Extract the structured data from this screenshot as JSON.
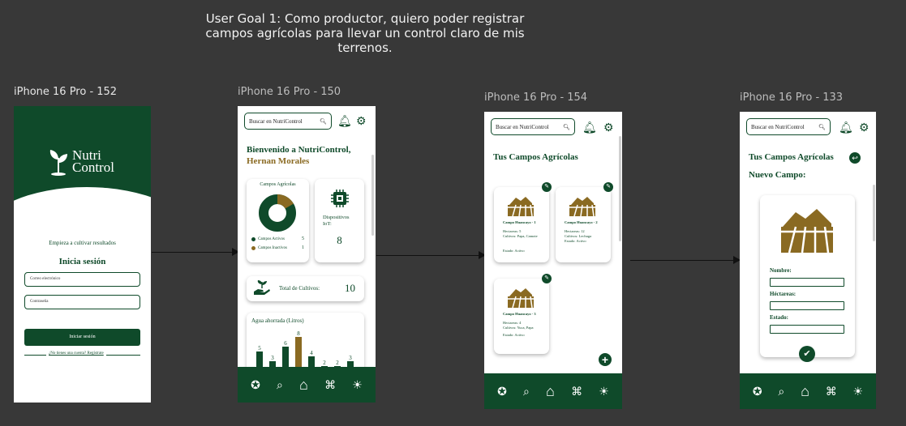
{
  "goal": {
    "line1": "User Goal 1: Como productor, quiero poder registrar",
    "line2": "campos agrícolas para llevar un control claro de mis",
    "line3": "terrenos."
  },
  "frames": [
    {
      "label": "iPhone 16 Pro - 152"
    },
    {
      "label": "iPhone 16 Pro - 150"
    },
    {
      "label": "iPhone 16 Pro - 154"
    },
    {
      "label": "iPhone 16 Pro - 133"
    }
  ],
  "login": {
    "logo_line1": "Nutri",
    "logo_line2": "Control",
    "tagline": "Empieza a cultivar resultados",
    "heading": "Inicia sesión",
    "email_placeholder": "Correo electrónico",
    "password_placeholder": "Contraseña",
    "submit": "Iniciar sesión",
    "register": "¿No tienes una cuenta? Regístrate"
  },
  "search_placeholder": "Buscar en NutriControl",
  "dashboard": {
    "welcome": "Bienvenido a NutriControl,",
    "user": "Hernan Morales",
    "fields_title": "Campos Agrícolas",
    "active_label": "Campos Activos",
    "active_count": "5",
    "inactive_label": "Campos Inactivos",
    "inactive_count": "1",
    "iot_label": "Dispositivos IoT:",
    "iot_count": "8",
    "crops_label": "Total de Cultivos:",
    "crops_count": "10",
    "water_title": "Agua ahorrada (Litros)"
  },
  "chart_data": {
    "type": "bar",
    "title": "Agua ahorrada (Litros)",
    "values": [
      5,
      3,
      6,
      8,
      4,
      2,
      2,
      3
    ],
    "highlight_index": 3,
    "colors": {
      "normal": "#0f4a2a",
      "highlight": "#8a6a22"
    }
  },
  "fields_list": {
    "title": "Tus Campos Agrícolas",
    "items": [
      {
        "name": "Campo Huancayo - 1",
        "hectares": "Hectareas: 5",
        "crops": "Cultivos: Papa, Camote",
        "status": "Estado: Activo"
      },
      {
        "name": "Campo Huancayo - 2",
        "hectares": "Hectareas: 12",
        "crops": "Cultivos: Lechuga",
        "status": "Estado: Activo"
      },
      {
        "name": "Campo Huancayo - 3",
        "hectares": "Hectareas: 4",
        "crops": "Cultivos: Yuca, Papa",
        "status": "Estado: Activo"
      }
    ]
  },
  "new_field": {
    "title": "Tus Campos Agrícolas",
    "subtitle": "Nuevo Campo:",
    "name_label": "Nombre:",
    "hectares_label": "Héctareas:",
    "status_label": "Estado:"
  },
  "colors": {
    "primary": "#0f4a2a",
    "accent": "#8a6a22",
    "canvas": "#383838"
  }
}
